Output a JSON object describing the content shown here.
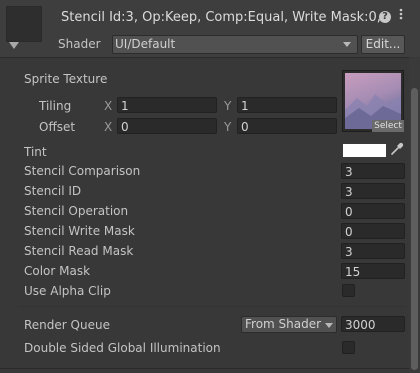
{
  "header": {
    "title": "Stencil Id:3, Op:Keep, Comp:Equal, Write Mask:0,",
    "shader_label": "Shader",
    "shader_value": "UI/Default",
    "edit_label": "Edit...",
    "help_icon": "?",
    "menu_icon": "⋮"
  },
  "sprite_texture": {
    "label": "Sprite Texture",
    "tiling_label": "Tiling",
    "offset_label": "Offset",
    "x_label": "X",
    "y_label": "Y",
    "tiling_x": "1",
    "tiling_y": "1",
    "offset_x": "0",
    "offset_y": "0",
    "select_label": "Select"
  },
  "tint": {
    "label": "Tint",
    "color": "#ffffff"
  },
  "properties": [
    {
      "label": "Stencil Comparison",
      "value": "3"
    },
    {
      "label": "Stencil ID",
      "value": "3"
    },
    {
      "label": "Stencil Operation",
      "value": "0"
    },
    {
      "label": "Stencil Write Mask",
      "value": "0"
    },
    {
      "label": "Stencil Read Mask",
      "value": "3"
    },
    {
      "label": "Color Mask",
      "value": "15"
    }
  ],
  "use_alpha_clip": {
    "label": "Use Alpha Clip",
    "checked": false
  },
  "render_queue": {
    "label": "Render Queue",
    "mode": "From Shader",
    "value": "3000"
  },
  "double_sided_gi": {
    "label": "Double Sided Global Illumination",
    "checked": false
  }
}
